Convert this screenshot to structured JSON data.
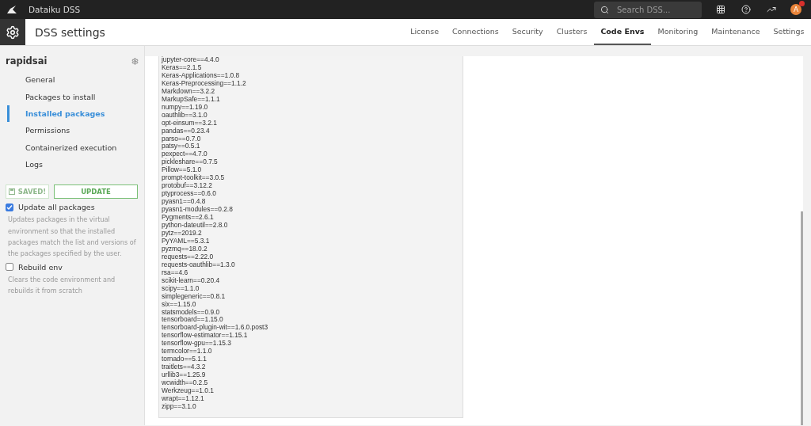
{
  "topbar": {
    "app_name": "Dataiku DSS",
    "search": {
      "placeholder": "Search DSS..."
    },
    "avatar": {
      "initial": "A",
      "notification": true
    }
  },
  "header": {
    "title": "DSS settings",
    "tabs": [
      {
        "label": "License",
        "selected": false
      },
      {
        "label": "Connections",
        "selected": false
      },
      {
        "label": "Security",
        "selected": false
      },
      {
        "label": "Clusters",
        "selected": false
      },
      {
        "label": "Code Envs",
        "selected": true
      },
      {
        "label": "Monitoring",
        "selected": false
      },
      {
        "label": "Maintenance",
        "selected": false
      },
      {
        "label": "Settings",
        "selected": false
      }
    ]
  },
  "sidebar": {
    "env_name": "rapidsai",
    "items": [
      {
        "label": "General",
        "selected": false
      },
      {
        "label": "Packages to install",
        "selected": false
      },
      {
        "label": "Installed packages",
        "selected": true
      },
      {
        "label": "Permissions",
        "selected": false
      },
      {
        "label": "Containerized execution",
        "selected": false
      },
      {
        "label": "Logs",
        "selected": false
      }
    ],
    "buttons": [
      {
        "label": "SAVED!",
        "kind": "save",
        "disabled": true
      },
      {
        "label": "UPDATE",
        "kind": "update",
        "disabled": false
      }
    ],
    "options": [
      {
        "label": "Update all packages",
        "checked": true,
        "help": "Updates packages in the virtual environment so that the installed packages match the list and versions of the packages specified by the user."
      },
      {
        "label": "Rebuild env",
        "checked": false,
        "help": "Clears the code environment and rebuilds it from scratch"
      }
    ]
  },
  "packages": [
    "jupyter-core==4.4.0",
    "Keras==2.1.5",
    "Keras-Applications==1.0.8",
    "Keras-Preprocessing==1.1.2",
    "Markdown==3.2.2",
    "MarkupSafe==1.1.1",
    "numpy==1.19.0",
    "oauthlib==3.1.0",
    "opt-einsum==3.2.1",
    "pandas==0.23.4",
    "parso==0.7.0",
    "patsy==0.5.1",
    "pexpect==4.7.0",
    "pickleshare==0.7.5",
    "Pillow==5.1.0",
    "prompt-toolkit==3.0.5",
    "protobuf==3.12.2",
    "ptyprocess==0.6.0",
    "pyasn1==0.4.8",
    "pyasn1-modules==0.2.8",
    "Pygments==2.6.1",
    "python-dateutil==2.8.0",
    "pytz==2019.2",
    "PyYAML==5.3.1",
    "pyzmq==18.0.2",
    "requests==2.22.0",
    "requests-oauthlib==1.3.0",
    "rsa==4.6",
    "scikit-learn==0.20.4",
    "scipy==1.1.0",
    "simplegeneric==0.8.1",
    "six==1.15.0",
    "statsmodels==0.9.0",
    "tensorboard==1.15.0",
    "tensorboard-plugin-wit==1.6.0.post3",
    "tensorflow-estimator==1.15.1",
    "tensorflow-gpu==1.15.3",
    "termcolor==1.1.0",
    "tornado==5.1.1",
    "traitlets==4.3.2",
    "urllib3==1.25.9",
    "wcwidth==0.2.5",
    "Werkzeug==1.0.1",
    "wrapt==1.12.1",
    "zipp==3.1.0"
  ]
}
